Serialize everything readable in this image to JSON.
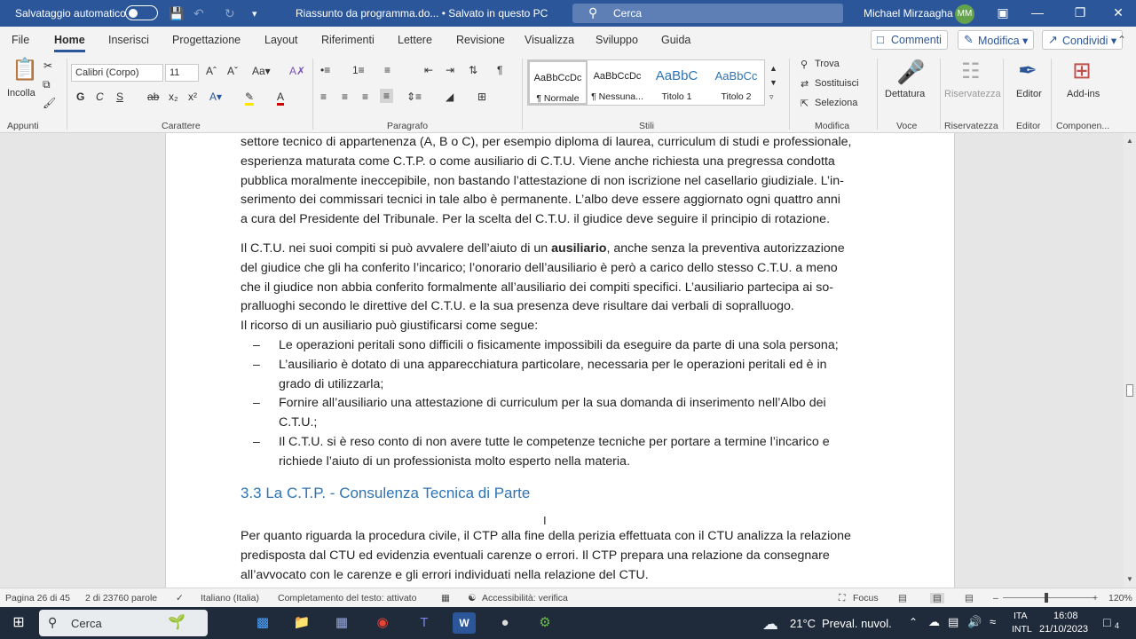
{
  "titlebar": {
    "autosave_label": "Salvataggio automatico",
    "doc_title": "Riassunto da programma.do... • Salvato in questo PC",
    "search_placeholder": "Cerca",
    "user_name": "Michael Mirzaagha",
    "user_initials": "MM"
  },
  "menu": {
    "tabs": [
      "File",
      "Home",
      "Inserisci",
      "Progettazione",
      "Layout",
      "Riferimenti",
      "Lettere",
      "Revisione",
      "Visualizza",
      "Sviluppo",
      "Guida"
    ],
    "active_tab": "Home",
    "comments_label": "Commenti",
    "edit_label": "Modifica",
    "share_label": "Condividi"
  },
  "ribbon": {
    "clipboard": {
      "paste_label": "Incolla",
      "group_label": "Appunti"
    },
    "font": {
      "font_name": "Calibri (Corpo)",
      "font_size": "11",
      "group_label": "Carattere"
    },
    "paragraph": {
      "group_label": "Paragrafo"
    },
    "styles": {
      "group_label": "Stili",
      "items": [
        {
          "preview": "AaBbCcDc",
          "name": "¶ Normale"
        },
        {
          "preview": "AaBbCcDc",
          "name": "¶ Nessuna..."
        },
        {
          "preview": "AaBbC",
          "name": "Titolo 1"
        },
        {
          "preview": "AaBbCc",
          "name": "Titolo 2"
        }
      ]
    },
    "editing": {
      "find": "Trova",
      "replace": "Sostituisci",
      "select": "Seleziona",
      "group_label": "Modifica"
    },
    "voice": {
      "dictate": "Dettatura",
      "group_label": "Voce"
    },
    "sensitivity": {
      "label": "Riservatezza",
      "group_label": "Riservatezza"
    },
    "editor": {
      "label": "Editor",
      "group_label": "Editor"
    },
    "addins": {
      "label": "Add-ins",
      "group_label": "Componen..."
    }
  },
  "document": {
    "para1_lines": [
      "settore tecnico di appartenenza (A, B o C), per esempio diploma di laurea, curriculum di studi e professionale,",
      "esperienza maturata come C.T.P. o come ausiliario di C.T.U. Viene anche richiesta una pregressa condotta",
      "pubblica moralmente ineccepibile, non bastando l’attestazione di non iscrizione nel casellario giudiziale. L’in-",
      "serimento dei commissari tecnici in tale albo è permanente. L’albo deve essere aggiornato ogni quattro anni",
      "a cura del Presidente del Tribunale. Per la scelta del C.T.U. il giudice deve seguire il principio di rotazione."
    ],
    "para2_before_bold": "Il C.T.U. nei suoi compiti si può avvalere dell’aiuto di un ",
    "para2_bold": "ausiliario",
    "para2_after_bold": ", anche senza la preventiva autorizzazione",
    "para2_lines": [
      "del giudice che gli ha conferito l’incarico; l’onorario dell’ausiliario è però a carico dello stesso C.T.U. a meno",
      "che il giudice non abbia conferito formalmente all’ausiliario dei compiti specifici. L’ausiliario partecipa ai so-",
      "pralluoghi secondo le direttive del C.T.U. e la sua presenza deve risultare dai verbali di sopralluogo."
    ],
    "para3": "Il ricorso di un ausiliario può giustificarsi come segue:",
    "list_dash": "–",
    "list_items": [
      [
        "Le operazioni peritali sono difficili o fisicamente impossibili da eseguire da parte di una sola persona;"
      ],
      [
        "L’ausiliario è dotato di una apparecchiatura particolare, necessaria per le operazioni peritali ed è in",
        "grado di utilizzarla;"
      ],
      [
        "Fornire all’ausiliario una attestazione di curriculum per la sua domanda di inserimento nell’Albo dei",
        "C.T.U.;"
      ],
      [
        "Il C.T.U. si è reso conto di non avere tutte le competenze tecniche per portare a termine l’incarico e",
        "richiede l’aiuto di un professionista molto esperto nella materia."
      ]
    ],
    "heading": "3.3 La C.T.P. - Consulenza Tecnica di Parte",
    "para4_lines": [
      "Per quanto riguarda la procedura civile, il CTP alla fine della perizia effettuata con il CTU analizza la relazione",
      "predisposta dal CTU ed evidenzia eventuali carenze o errori. Il CTP prepara una relazione da consegnare",
      "all’avvocato con le carenze e gli errori individuati nella relazione del CTU."
    ]
  },
  "statusbar": {
    "page": "Pagina 26 di 45",
    "words": "2 di 23760 parole",
    "language": "Italiano (Italia)",
    "autocomplete": "Completamento del testo: attivato",
    "accessibility": "Accessibilità: verifica",
    "focus": "Focus",
    "zoom": "120%"
  },
  "taskbar": {
    "search_placeholder": "Cerca",
    "weather_temp": "21°C",
    "weather_desc": "Preval. nuvol.",
    "lang_top": "ITA",
    "lang_bottom": "INTL",
    "time": "16:08",
    "date": "21/10/2023",
    "notification_count": "4"
  }
}
